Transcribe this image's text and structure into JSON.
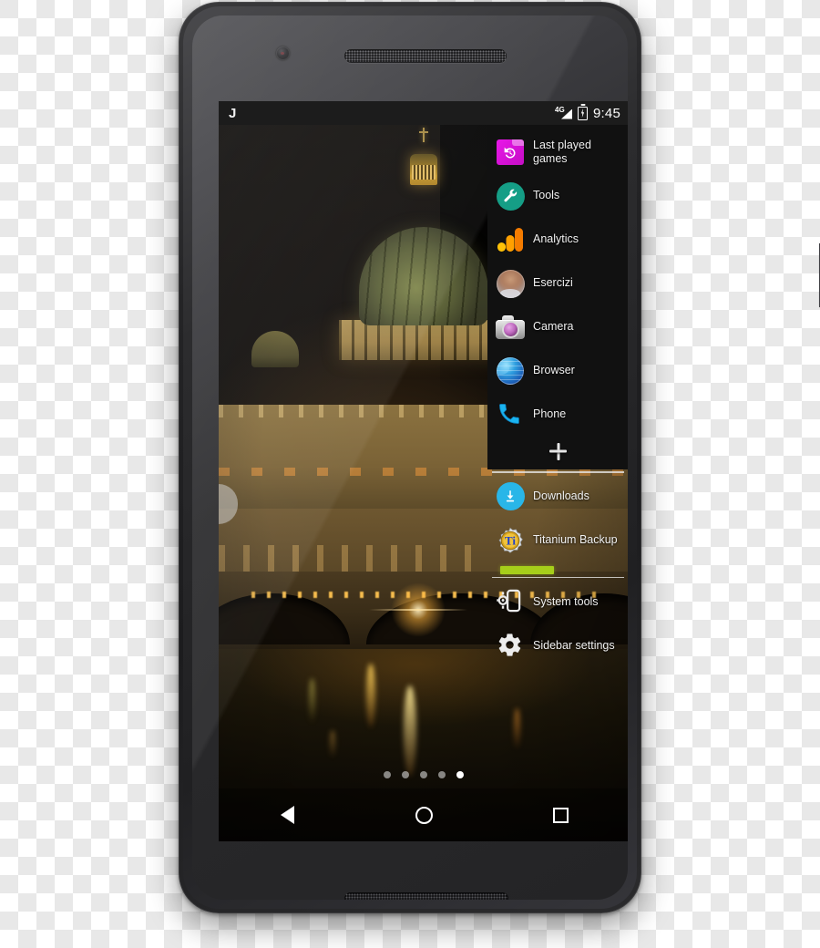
{
  "device": {
    "name": "android-smartphone",
    "front_camera": "front-camera-icon",
    "earpiece": "earpiece-speaker",
    "bottom_speaker": "bottom-speaker",
    "power_button": "power-button"
  },
  "status_bar": {
    "app_badge": "J",
    "network": "4G",
    "battery_state": "charging",
    "time": "9:45"
  },
  "wallpaper": {
    "description": "Saint Peter's Basilica at night reflected in the Tiber river"
  },
  "sidebar": {
    "handle_label": "sidebar-trigger-handle",
    "top_items": [
      {
        "label": "Last played games",
        "icon": "last-played-games-icon"
      },
      {
        "label": "Tools",
        "icon": "wrench-icon"
      },
      {
        "label": "Analytics",
        "icon": "google-analytics-icon"
      },
      {
        "label": "Esercizi",
        "icon": "contact-avatar-icon"
      },
      {
        "label": "Camera",
        "icon": "camera-icon"
      },
      {
        "label": "Browser",
        "icon": "browser-globe-icon"
      },
      {
        "label": "Phone",
        "icon": "phone-handset-icon"
      }
    ],
    "add_button": {
      "label": "+",
      "icon": "plus-icon"
    },
    "bottom_items": [
      {
        "label": "Downloads",
        "icon": "download-icon"
      },
      {
        "label": "Titanium Backup",
        "icon": "titanium-backup-icon"
      }
    ],
    "progress": {
      "percent": 44,
      "color": "#a6ce1a"
    },
    "footer_items": [
      {
        "label": "System tools",
        "icon": "phone-gear-icon"
      },
      {
        "label": "Sidebar settings",
        "icon": "gear-icon"
      }
    ]
  },
  "home_screen": {
    "page_dots": {
      "count": 5,
      "active_index": 4
    }
  },
  "nav_bar": {
    "back": "back-triangle-icon",
    "home": "home-circle-icon",
    "recents": "recents-square-icon"
  },
  "colors": {
    "sidebar_bg": "#111111",
    "accent_green": "#a6ce1a",
    "status_bar_bg": "#1c1c1c"
  }
}
